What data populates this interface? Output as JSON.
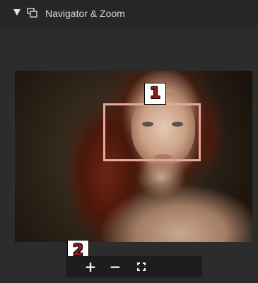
{
  "panel": {
    "title": "Navigator & Zoom",
    "collapse_icon": "triangle-down-icon",
    "panel_icon": "navigator-icon"
  },
  "preview": {
    "alt": "Portrait of a red-haired woman with freckles",
    "zoom_box_color": "#e7a79a"
  },
  "callouts": {
    "one": "1",
    "two": "2"
  },
  "toolbar": {
    "zoom_in_label": "+",
    "zoom_out_label": "−",
    "fit_icon": "fit-screen-icon"
  }
}
